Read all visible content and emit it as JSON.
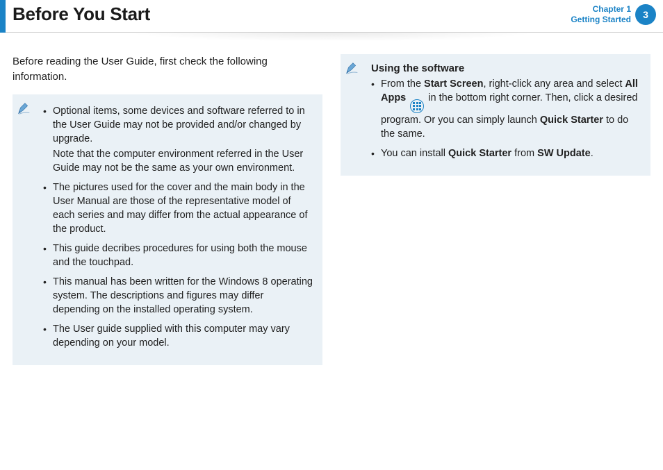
{
  "header": {
    "title": "Before You Start",
    "chapter_line1": "Chapter 1",
    "chapter_line2": "Getting Started",
    "page_number": "3"
  },
  "intro": "Before reading the User Guide, first check the following information.",
  "left_box": {
    "items": [
      {
        "text": "Optional items, some devices and software referred to in the User Guide may not be provided and/or changed by upgrade.",
        "sub": "Note that the computer environment referred in the User Guide may not be the same as your own environment."
      },
      {
        "text": "The pictures used for the cover and the main body in the User Manual are those of the representative model of each series and may differ from the actual appearance of the product."
      },
      {
        "text": "This guide decribes procedures for using both the mouse and the touchpad."
      },
      {
        "text": "This manual has been written for the Windows 8 operating system. The descriptions and figures may differ depending on the installed operating system."
      },
      {
        "text": "The User guide supplied with this computer may vary depending on your model."
      }
    ]
  },
  "right_box": {
    "heading": "Using the software",
    "item1": {
      "pre": "From the ",
      "b1": "Start Screen",
      "mid1": ", right-click any area and select ",
      "b2": "All Apps",
      "mid2": " in the bottom right corner. Then, click a desired program. Or you can simply launch ",
      "b3": "Quick Starter",
      "post": " to do the same."
    },
    "item2": {
      "pre": "You can install ",
      "b1": "Quick Starter",
      "mid": " from ",
      "b2": "SW Update",
      "post": "."
    }
  }
}
